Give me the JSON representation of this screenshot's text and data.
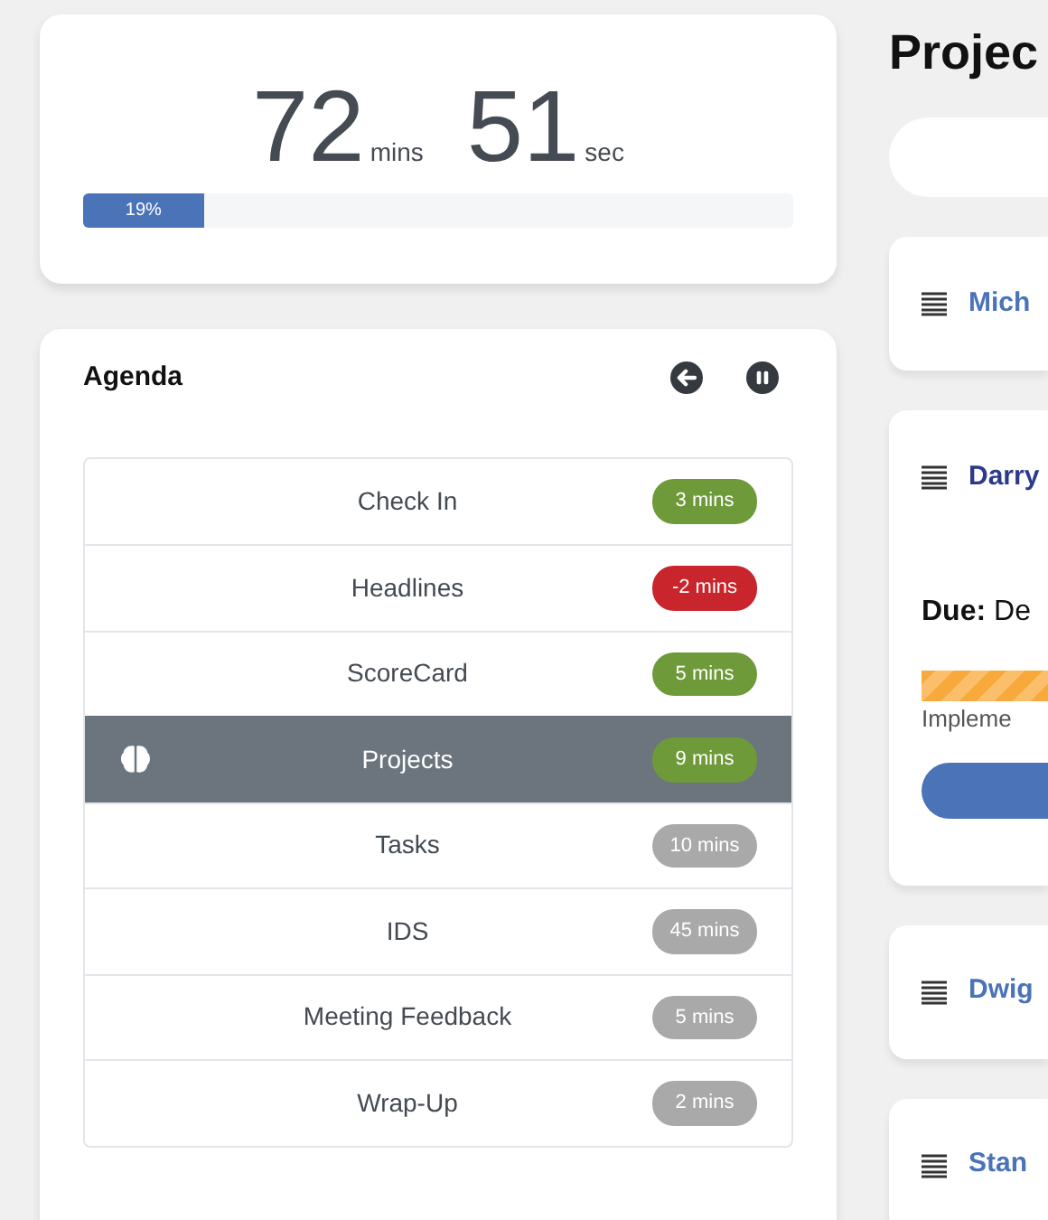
{
  "timer": {
    "minutes": "72",
    "minutes_unit": "mins",
    "seconds": "51",
    "seconds_unit": "sec",
    "progress_label": "19%",
    "level": 0.17
  },
  "agenda": {
    "title": "Agenda",
    "items": [
      {
        "label": "Check In",
        "time": "3 mins",
        "color": "#6f9a3a",
        "selected": false
      },
      {
        "label": "Headlines",
        "time": "-2 mins",
        "color": "#c9252c",
        "selected": false
      },
      {
        "label": "ScoreCard",
        "time": "5 mins",
        "color": "#6f9a3a",
        "selected": false
      },
      {
        "label": "Projects",
        "time": "9 mins",
        "color": "#6f9a3a",
        "selected": true
      },
      {
        "label": "Tasks",
        "time": "10 mins",
        "color": "#a9a9a9",
        "selected": false
      },
      {
        "label": "IDS",
        "time": "45 mins",
        "color": "#a9a9a9",
        "selected": false
      },
      {
        "label": "Meeting Feedback",
        "time": "5 mins",
        "color": "#a9a9a9",
        "selected": false
      },
      {
        "label": "Wrap-Up",
        "time": "2 mins",
        "color": "#a9a9a9",
        "selected": false
      }
    ]
  },
  "projects": {
    "title": "Projec",
    "cards": [
      {
        "owner": "Mich",
        "expanded": false
      },
      {
        "owner": "Darry",
        "expanded": true,
        "due_label": "Due:",
        "due_value": "De",
        "status_text": "Impleme"
      },
      {
        "owner": "Dwig",
        "expanded": false
      },
      {
        "owner": "Stan",
        "expanded": false
      }
    ]
  }
}
